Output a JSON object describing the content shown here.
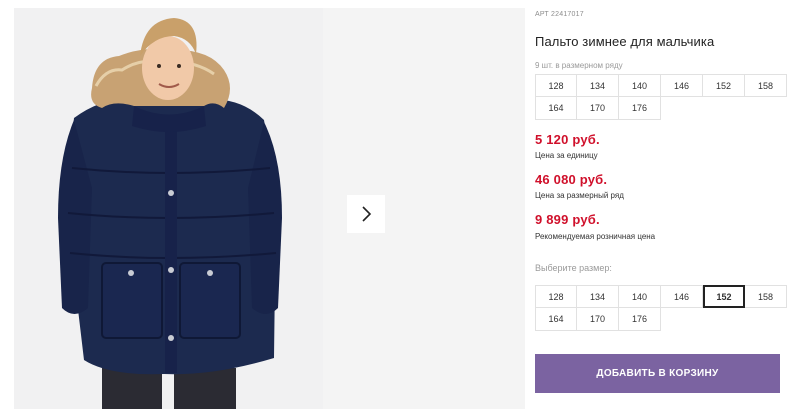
{
  "product": {
    "sku": "АРТ 22417017",
    "title": "Пальто зимнее для мальчика",
    "image_alt": "boy in navy winter coat with fur hood"
  },
  "gallery": {
    "next_icon": "chevron-right-icon"
  },
  "sizes_info": {
    "note": "9 шт. в размерном ряду",
    "sizes": [
      "128",
      "134",
      "140",
      "146",
      "152",
      "158",
      "164",
      "170",
      "176"
    ]
  },
  "prices": {
    "unit_price": "5 120 руб.",
    "unit_label": "Цена за единицу",
    "set_price": "46 080 руб.",
    "set_label": "Цена за размерный ряд",
    "retail_price": "9 899 руб.",
    "retail_label": "Рекомендуемая розничная цена",
    "price_color": "#d0102b"
  },
  "size_select": {
    "label": "Выберите размер:",
    "sizes": [
      "128",
      "134",
      "140",
      "146",
      "152",
      "158",
      "164",
      "170",
      "176"
    ],
    "selected": "152"
  },
  "cart": {
    "button_label": "ДОБАВИТЬ В КОРЗИНУ",
    "button_color": "#7b63a1"
  }
}
